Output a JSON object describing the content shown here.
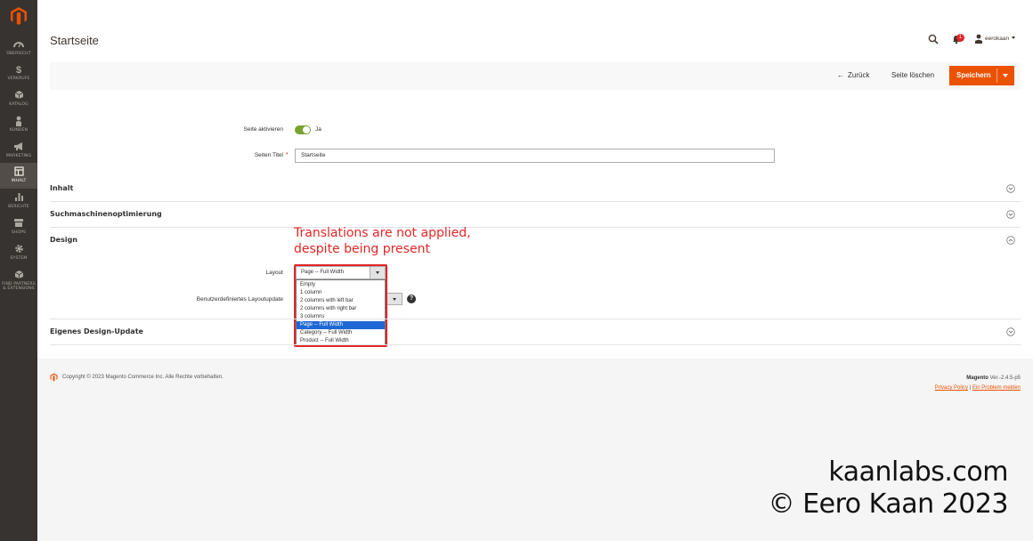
{
  "sidebar": {
    "items": [
      {
        "label": "ÜBERSICHT",
        "icon": "dashboard-icon"
      },
      {
        "label": "VERKÄUFE",
        "icon": "dollar-icon"
      },
      {
        "label": "KATALOG",
        "icon": "box-icon"
      },
      {
        "label": "KUNDEN",
        "icon": "person-icon"
      },
      {
        "label": "MARKETING",
        "icon": "megaphone-icon"
      },
      {
        "label": "INHALT",
        "icon": "content-icon"
      },
      {
        "label": "BERICHTE",
        "icon": "bar-chart-icon"
      },
      {
        "label": "SHOPS",
        "icon": "store-icon"
      },
      {
        "label": "SYSTEM",
        "icon": "gear-icon"
      },
      {
        "label": "FIND PARTNERS & EXTENSIONS",
        "icon": "cube-icon"
      }
    ],
    "active": "INHALT"
  },
  "header": {
    "title": "Startseite",
    "notification_count": "1",
    "user_name": "eerokaan"
  },
  "actions": {
    "back_label": "Zurück",
    "delete_label": "Seite löschen",
    "save_label": "Speichern"
  },
  "form": {
    "active_label": "Seite aktivieren",
    "active_value": "Ja",
    "title_label": "Seiten Titel",
    "title_value": "Startseite"
  },
  "sections": {
    "content": "Inhalt",
    "seo": "Suchmaschinenoptimierung",
    "design": "Design",
    "custom_design": "Eigenes Design-Update"
  },
  "design": {
    "layout_label": "Layout",
    "layout_value": "Page -- Full Width",
    "layout_options": [
      "Empty",
      "1 column",
      "2 columns with left bar",
      "2 columns with right bar",
      "3 columns",
      "Page -- Full Width",
      "Category -- Full Width",
      "Product -- Full Width"
    ],
    "selected_index": 5,
    "custom_update_label": "Benutzerdefiniertes Layoutupdate"
  },
  "annotation": {
    "line1": "Translations are not applied,",
    "line2": "despite being present"
  },
  "footer": {
    "copyright": "Copyright © 2023 Magento Commerce Inc. Alle Rechte vorbehalten.",
    "magento": "Magento",
    "version": "Ver.-2.4.5-p5",
    "privacy": "Privacy Policy",
    "separator": "|",
    "report": "Ein Problem melden"
  },
  "watermark": {
    "line1": "kaanlabs.com",
    "line2": "© Eero Kaan 2023"
  },
  "colors": {
    "sidebar_bg": "#373330",
    "accent": "#eb5202",
    "toggle_on": "#79a22e",
    "annotation_red": "#e22626",
    "selected_option": "#1e68d6"
  }
}
